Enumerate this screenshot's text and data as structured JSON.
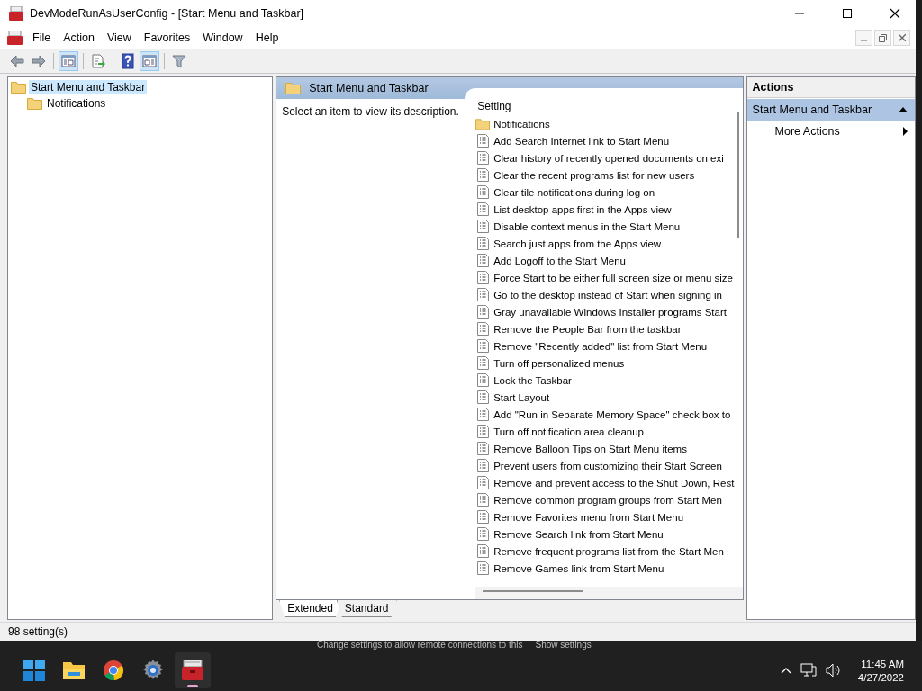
{
  "window": {
    "title": "DevModeRunAsUserConfig - [Start Menu and Taskbar]"
  },
  "menu_bar": {
    "items": [
      "File",
      "Action",
      "View",
      "Favorites",
      "Window",
      "Help"
    ]
  },
  "toolbar": {
    "groups": [
      [
        {
          "kind": "back",
          "pressed": false
        },
        {
          "kind": "forward",
          "pressed": false
        }
      ],
      [
        {
          "kind": "console-tree",
          "pressed": true
        }
      ],
      [
        {
          "kind": "export",
          "pressed": false
        }
      ],
      [
        {
          "kind": "help",
          "pressed": false
        },
        {
          "kind": "action-pane",
          "pressed": true
        }
      ],
      [
        {
          "kind": "filter",
          "pressed": false
        }
      ]
    ]
  },
  "tree": {
    "items": [
      {
        "label": "Start Menu and Taskbar",
        "selected": true,
        "children": [
          {
            "label": "Notifications",
            "selected": false
          }
        ]
      }
    ]
  },
  "details": {
    "title": "Start Menu and Taskbar",
    "description": "Select an item to view its description.",
    "column_header": "Setting",
    "rows": [
      {
        "kind": "folder",
        "label": "Notifications"
      },
      {
        "kind": "setting",
        "label": "Add Search Internet link to Start Menu"
      },
      {
        "kind": "setting",
        "label": "Clear history of recently opened documents on exi"
      },
      {
        "kind": "setting",
        "label": "Clear the recent programs list for new users"
      },
      {
        "kind": "setting",
        "label": "Clear tile notifications during log on"
      },
      {
        "kind": "setting",
        "label": "List desktop apps first in the Apps view"
      },
      {
        "kind": "setting",
        "label": "Disable context menus in the Start Menu"
      },
      {
        "kind": "setting",
        "label": "Search just apps from the Apps view"
      },
      {
        "kind": "setting",
        "label": "Add Logoff to the Start Menu"
      },
      {
        "kind": "setting",
        "label": "Force Start to be either full screen size or menu size"
      },
      {
        "kind": "setting",
        "label": "Go to the desktop instead of Start when signing in"
      },
      {
        "kind": "setting",
        "label": "Gray unavailable Windows Installer programs Start"
      },
      {
        "kind": "setting",
        "label": "Remove the People Bar from the taskbar"
      },
      {
        "kind": "setting",
        "label": "Remove \"Recently added\" list from Start Menu"
      },
      {
        "kind": "setting",
        "label": "Turn off personalized menus"
      },
      {
        "kind": "setting",
        "label": "Lock the Taskbar"
      },
      {
        "kind": "setting",
        "label": "Start Layout"
      },
      {
        "kind": "setting",
        "label": "Add \"Run in Separate Memory Space\" check box to"
      },
      {
        "kind": "setting",
        "label": "Turn off notification area cleanup"
      },
      {
        "kind": "setting",
        "label": "Remove Balloon Tips on Start Menu items"
      },
      {
        "kind": "setting",
        "label": "Prevent users from customizing their Start Screen"
      },
      {
        "kind": "setting",
        "label": "Remove and prevent access to the Shut Down, Rest"
      },
      {
        "kind": "setting",
        "label": "Remove common program groups from Start Men"
      },
      {
        "kind": "setting",
        "label": "Remove Favorites menu from Start Menu"
      },
      {
        "kind": "setting",
        "label": "Remove Search link from Start Menu"
      },
      {
        "kind": "setting",
        "label": "Remove frequent programs list from the Start Men"
      },
      {
        "kind": "setting",
        "label": "Remove Games link from Start Menu"
      }
    ]
  },
  "view_tabs": [
    {
      "label": "Extended",
      "selected": true
    },
    {
      "label": "Standard",
      "selected": false
    }
  ],
  "actions": {
    "title": "Actions",
    "sections": [
      {
        "label": "Start Menu and Taskbar",
        "items": [
          {
            "label": "More Actions"
          }
        ]
      }
    ]
  },
  "status_bar": "98 setting(s)",
  "background_notice": {
    "text": "Change settings to allow remote connections to this",
    "link": "Show settings"
  },
  "taskbar": {
    "apps": [
      {
        "kind": "start",
        "active": false
      },
      {
        "kind": "explorer",
        "active": false
      },
      {
        "kind": "browser",
        "active": false
      },
      {
        "kind": "settings",
        "active": false
      },
      {
        "kind": "toolbox",
        "active": true
      }
    ],
    "time": "11:45 AM",
    "date": "4/27/2022"
  }
}
